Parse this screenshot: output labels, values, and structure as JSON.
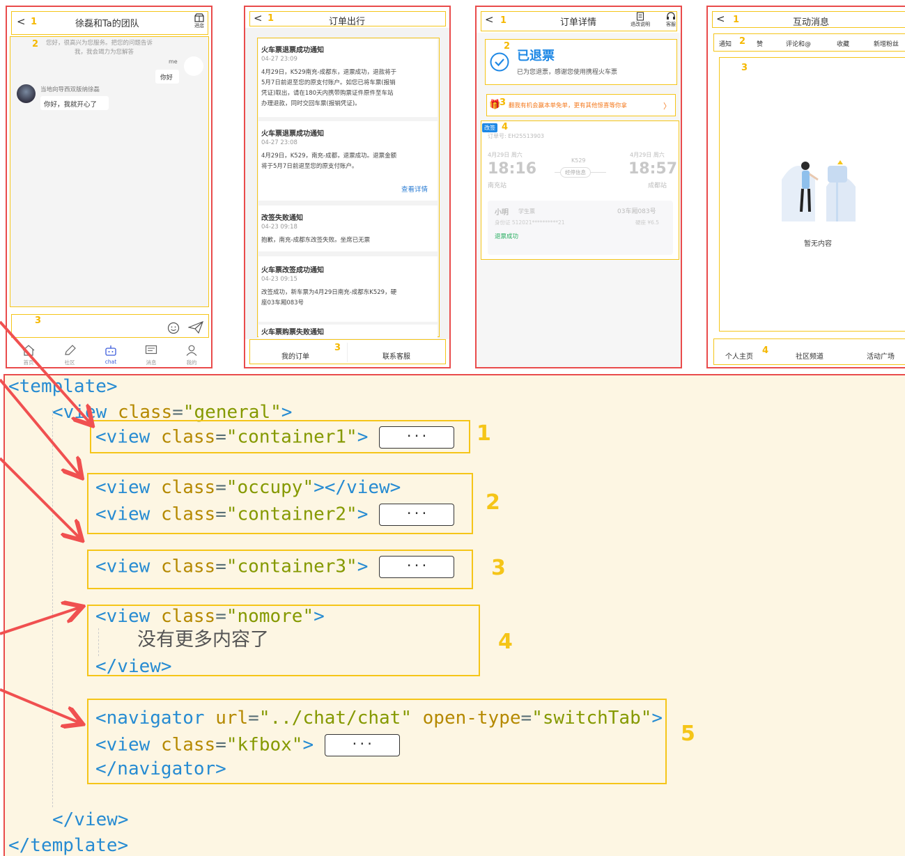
{
  "phone1": {
    "title": "徐磊和Ta的团队",
    "shop_label": "进店",
    "welcome_line1": "您好，很高兴为您服务。把您的问题告诉",
    "welcome_line2": "我，我会竭力为您解答",
    "me_name": "me",
    "me_msg": "你好",
    "other_name": "当地向导西双版纳徐磊",
    "other_msg": "你好，我就开心了",
    "tabbar": [
      {
        "label": "首页",
        "icon": "home-icon"
      },
      {
        "label": "社区",
        "icon": "community-icon"
      },
      {
        "label": "chat",
        "icon": "robot-icon"
      },
      {
        "label": "消息",
        "icon": "message-icon"
      },
      {
        "label": "我的",
        "icon": "user-icon"
      }
    ],
    "active_color": "#3b5bdb"
  },
  "phone2": {
    "title": "订单出行",
    "notices": [
      {
        "title": "火车票退票成功通知",
        "time": "04-27 23:09",
        "lines": [
          "4月29日，K529南充-成都东，退票成功，退款将于",
          "5月7日前退至您的原支付账户。如您已将车票(报销",
          "凭证)取出，请在180天内携带购票证件原件至车站",
          "办理退款，同时交回车票(报销凭证)。"
        ]
      },
      {
        "title": "火车票退票成功通知",
        "time": "04-27 23:08",
        "lines": [
          "4月29日，K529，南充-成都，退票成功。退票金额",
          "将于5月7日前退至您的原支付账户。"
        ],
        "link": "查看详情"
      },
      {
        "title": "改签失败通知",
        "time": "04-23 09:18",
        "lines": [
          "抱歉，南充-成都东改签失败。坐席已无票"
        ]
      },
      {
        "title": "火车票改签成功通知",
        "time": "04-23 09:15",
        "lines": [
          "改签成功，新车票为4月29日南充-成都东K529，硬",
          "座03车厢083号"
        ]
      },
      {
        "title": "火车票购票失败通知"
      }
    ],
    "my_orders": "我的订单",
    "contact": "联系客服",
    "link_color": "#2b7cd3"
  },
  "phone3": {
    "title": "订单详情",
    "rule_label": "退改说明",
    "service_label": "客服",
    "status": "已退票",
    "status_sub": "已为您退票，感谢您使用携程火车票",
    "promo": "翻我有机会赢本单免单，更有其他惊喜等你拿",
    "badge": "改签",
    "order_no": "订单号: EH25513903",
    "dep_date": "4月29日 周六",
    "arr_date": "4月29日 周六",
    "train_no": "K529",
    "dep_time": "18:16",
    "arr_time": "18:57",
    "stop_info": "经停信息",
    "dep_station": "南充站",
    "arr_station": "成都站",
    "passenger": "小明",
    "ptype": "学生票",
    "seat": "03车厢083号",
    "idcard": "身份证 512021**********21",
    "price": "硬座 ¥6.5",
    "refund_state": "退票成功",
    "accent": "#1e88e5",
    "promo_color": "#f47b20",
    "refund_color": "#27ae60"
  },
  "phone4": {
    "title": "互动消息",
    "tabs": [
      "通知",
      "赞",
      "评论和@",
      "收藏",
      "新增粉丝"
    ],
    "empty": "暂无内容",
    "bottom": [
      "个人主页",
      "社区频道",
      "活动广场"
    ]
  },
  "numbers": [
    "1",
    "2",
    "3",
    "4",
    "5"
  ],
  "code": {
    "template_open": "<template>",
    "view_open": "<view",
    "class_attr": "class",
    "general": "\"general\"",
    "container1": "\"container1\"",
    "occupy": "\"occupy\"",
    "container2": "\"container2\"",
    "container3": "\"container3\"",
    "nomore": "\"nomore\"",
    "nomore_text": "没有更多内容了",
    "kfbox": "\"kfbox\"",
    "navigator_open": "<navigator",
    "url_attr": "url",
    "url_val": "\"../chat/chat\"",
    "open_type_attr": "open-type",
    "open_type_val": "\"switchTab\"",
    "ellipsis": "···",
    "view_close": "</view>",
    "navigator_close": "</navigator>",
    "template_close": "</template>"
  },
  "arrow_color": "#f05050"
}
